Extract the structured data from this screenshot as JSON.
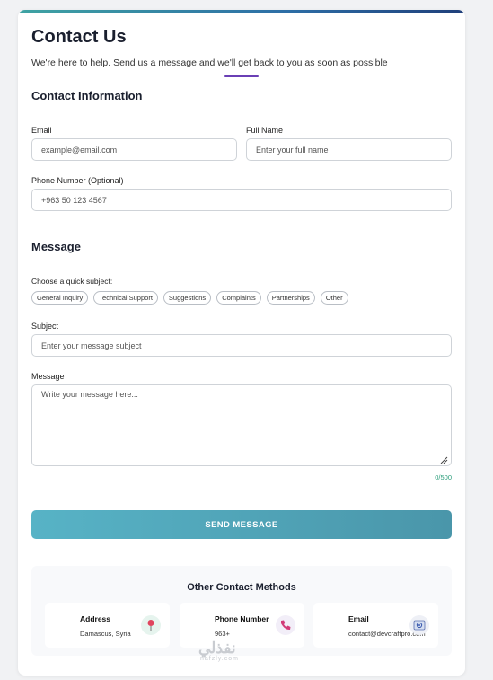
{
  "header": {
    "title": "Contact Us",
    "subtitle": "We're here to help. Send us a message and we'll get back to you as soon as possible"
  },
  "contact_info": {
    "heading": "Contact Information",
    "email_label": "Email",
    "email_placeholder": "example@email.com",
    "fullname_label": "Full Name",
    "fullname_placeholder": "Enter your full name",
    "phone_label": "Phone Number (Optional)",
    "phone_placeholder": "+963 50 123 4567"
  },
  "message_section": {
    "heading": "Message",
    "quick_subject_label": "Choose a quick subject:",
    "chips": [
      "General Inquiry",
      "Technical Support",
      "Suggestions",
      "Complaints",
      "Partnerships",
      "Other"
    ],
    "subject_label": "Subject",
    "subject_placeholder": "Enter your message subject",
    "message_label": "Message",
    "message_placeholder": "Write your message here...",
    "counter": "0/500"
  },
  "send_button": "SEND MESSAGE",
  "other_methods": {
    "heading": "Other Contact Methods",
    "cards": [
      {
        "title": "Address",
        "value": "Damascus, Syria",
        "icon": "pin-icon"
      },
      {
        "title": "Phone Number",
        "value": "963+",
        "icon": "phone-icon"
      },
      {
        "title": "Email",
        "value": "contact@devcraftpro.com",
        "icon": "at-icon"
      }
    ]
  },
  "watermark": {
    "arabic": "نفذلي",
    "latin": "nafzly.com"
  },
  "colors": {
    "accent": "#3aa0a0",
    "title_rule": "#6a3fb5",
    "button": "#4fa5b8",
    "counter": "#2a9d7a"
  }
}
